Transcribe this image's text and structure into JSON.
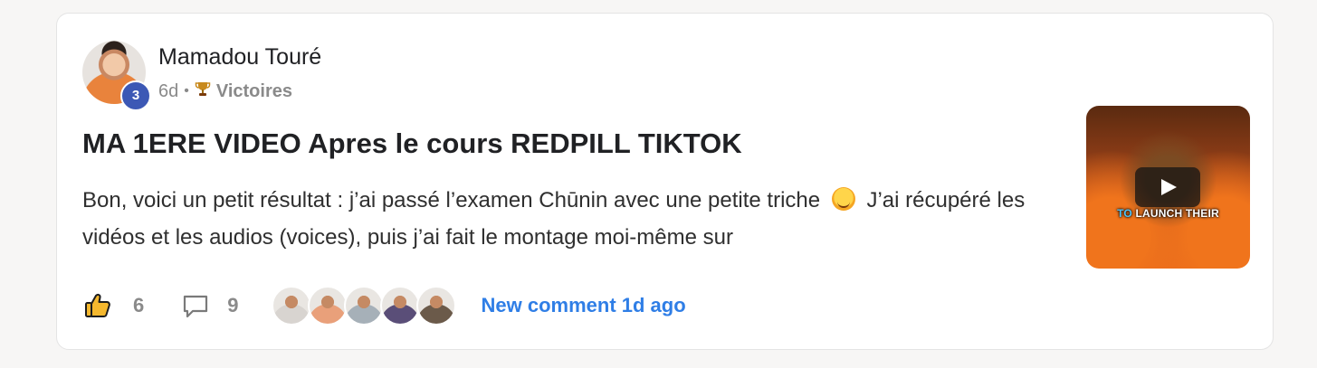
{
  "post": {
    "author": "Mamadou Touré",
    "level": "3",
    "time": "6d",
    "separator": "•",
    "category_icon": "trophy-icon",
    "category": "Victoires",
    "title": "MA 1ERE VIDEO Apres le cours REDPILL TIKTOK",
    "body_part1": "Bon, voici un petit résultat : j’ai passé l’examen Chūnin avec une petite triche",
    "body_emoji": "winking-face-emoji",
    "body_part2": "J’ai récupéré les vidéos et les audios (voices), puis j’ai fait le montage moi-même sur",
    "thumbnail": {
      "caption_highlight": "TO",
      "caption_rest": "LAUNCH THEIR"
    }
  },
  "footer": {
    "likes": "6",
    "comments": "9",
    "new_comment": "New comment 1d ago",
    "avatar_colors": [
      "#d8d4d0",
      "#e9a07a",
      "#a6b0b8",
      "#5a4e78",
      "#6b5a4a"
    ]
  },
  "colors": {
    "accent_blue": "#2f7ee6",
    "badge_blue": "#3c58b5"
  }
}
